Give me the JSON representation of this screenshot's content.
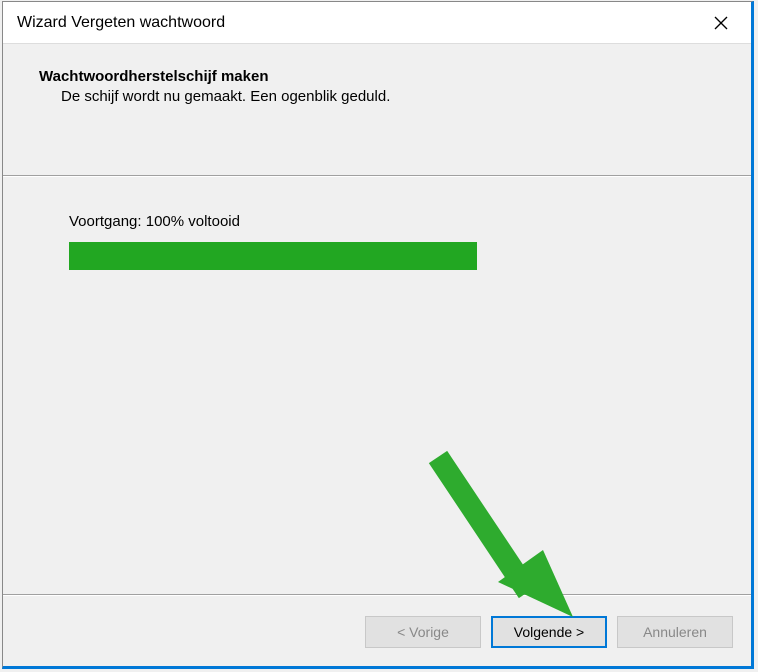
{
  "window": {
    "title": "Wizard Vergeten wachtwoord"
  },
  "content": {
    "heading": "Wachtwoordherstelschijf maken",
    "subheading": "De schijf wordt nu gemaakt. Een ogenblik geduld."
  },
  "progress": {
    "label": "Voortgang: 100% voltooid",
    "percent": 100
  },
  "buttons": {
    "back": "< Vorige",
    "next": "Volgende >",
    "cancel": "Annuleren"
  }
}
